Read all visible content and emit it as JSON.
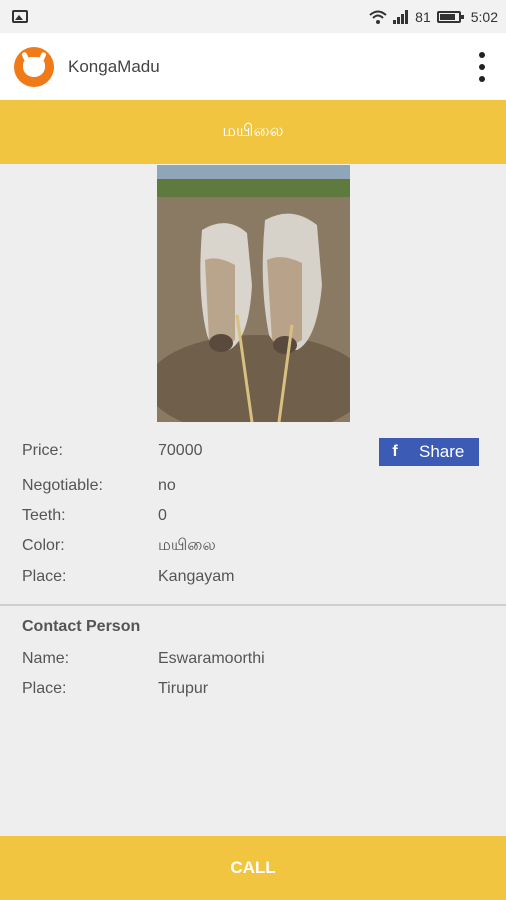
{
  "status_bar": {
    "left_icon": "image-icon",
    "signal": "81",
    "time": "5:02"
  },
  "app": {
    "title": "KongaMadu",
    "logo_icon": "cow-logo-icon",
    "menu_icon": "overflow-menu-icon"
  },
  "listing": {
    "title": "மயிலை",
    "photo_icon": "cattle-photo"
  },
  "details": [
    {
      "label": "Price:",
      "value": "70000"
    },
    {
      "label": "Negotiable:",
      "value": "no"
    },
    {
      "label": "Teeth:",
      "value": "0"
    },
    {
      "label": "Color:",
      "value": "மயிலை"
    },
    {
      "label": "Place:",
      "value": "Kangayam"
    }
  ],
  "share": {
    "icon": "f",
    "label": "Share",
    "color": "#3b5bb5"
  },
  "contact": {
    "heading": "Contact Person",
    "rows": [
      {
        "label": "Name:",
        "value": "Eswaramoorthi"
      },
      {
        "label": "Place:",
        "value": "Tirupur"
      }
    ]
  },
  "call": {
    "label": "CALL"
  },
  "colors": {
    "accent": "#f2c541",
    "logo": "#f07a17",
    "background": "#eeeeee"
  }
}
